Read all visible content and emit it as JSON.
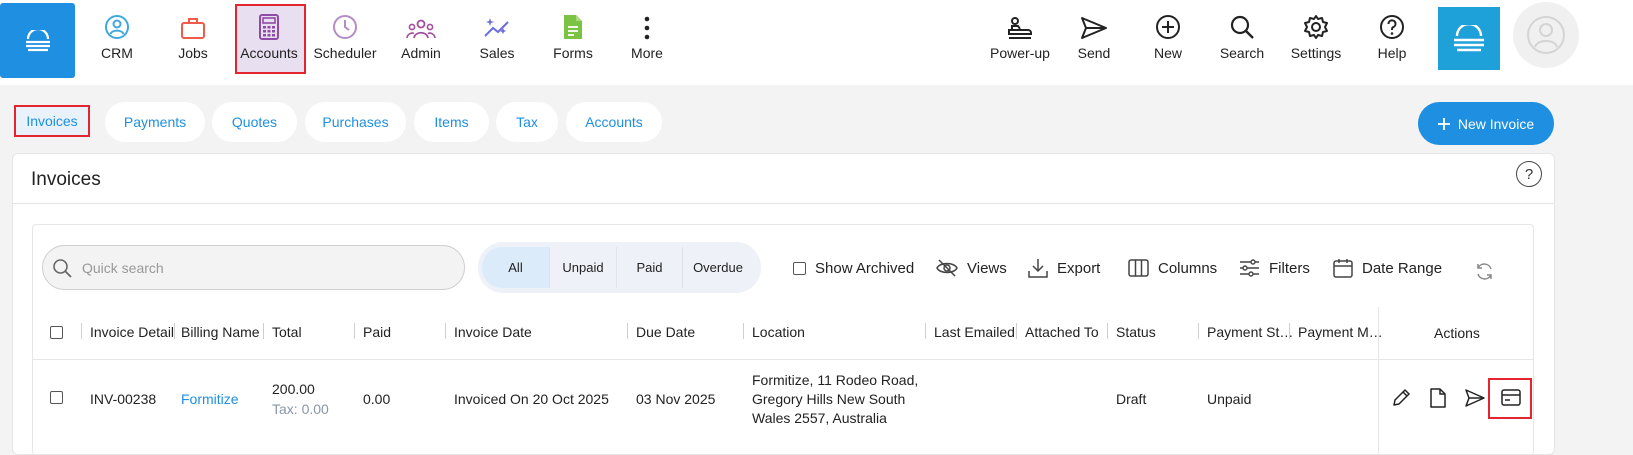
{
  "nav": {
    "items": [
      {
        "label": "CRM",
        "icon": "crm-icon",
        "color": "#3fa9de"
      },
      {
        "label": "Jobs",
        "icon": "briefcase-icon",
        "color": "#f05a4a"
      },
      {
        "label": "Accounts",
        "icon": "calculator-icon",
        "color": "#8e4ca8"
      },
      {
        "label": "Scheduler",
        "icon": "clock-icon",
        "color": "#b48cc6"
      },
      {
        "label": "Admin",
        "icon": "users-icon",
        "color": "#a24e9c"
      },
      {
        "label": "Sales",
        "icon": "sparkle-chart-icon",
        "color": "#6b6fdc"
      },
      {
        "label": "Forms",
        "icon": "document-icon",
        "color": "#7cc243"
      },
      {
        "label": "More",
        "icon": "more-vertical-icon",
        "color": "#222222"
      }
    ],
    "right_items": [
      {
        "label": "Power-up",
        "icon": "power-up-icon"
      },
      {
        "label": "Send",
        "icon": "send-icon"
      },
      {
        "label": "New",
        "icon": "plus-circle-icon"
      },
      {
        "label": "Search",
        "icon": "search-icon"
      },
      {
        "label": "Settings",
        "icon": "gear-icon"
      },
      {
        "label": "Help",
        "icon": "help-icon"
      }
    ]
  },
  "subtabs": [
    "Invoices",
    "Payments",
    "Quotes",
    "Purchases",
    "Items",
    "Tax",
    "Accounts"
  ],
  "new_invoice_label": "New Invoice",
  "panel": {
    "title": "Invoices",
    "help": "?"
  },
  "toolbar": {
    "search_placeholder": "Quick search",
    "filters": [
      "All",
      "Unpaid",
      "Paid",
      "Overdue"
    ],
    "show_archived": "Show Archived",
    "views": "Views",
    "export": "Export",
    "columns": "Columns",
    "filters_label": "Filters",
    "date_range": "Date Range"
  },
  "table": {
    "headers": [
      "Invoice Detail",
      "Billing Name",
      "Total",
      "Paid",
      "Invoice Date",
      "Due Date",
      "Location",
      "Last Emailed",
      "Attached To",
      "Status",
      "Payment St…",
      "Payment M…",
      "Actions"
    ],
    "rows": [
      {
        "invoice": "INV-00238",
        "billing_name": "Formitize",
        "total": "200.00",
        "tax": "Tax: 0.00",
        "paid": "0.00",
        "invoice_date": "Invoiced On 20 Oct 2025",
        "due_date": "03 Nov 2025",
        "location_lines": [
          "Formitize, 11 Rodeo Road,",
          "Gregory Hills New South",
          "Wales 2557, Australia"
        ],
        "status": "Draft",
        "payment_status": "Unpaid"
      }
    ]
  },
  "colors": {
    "accent": "#1e8fe1",
    "highlight": "#e32530"
  }
}
